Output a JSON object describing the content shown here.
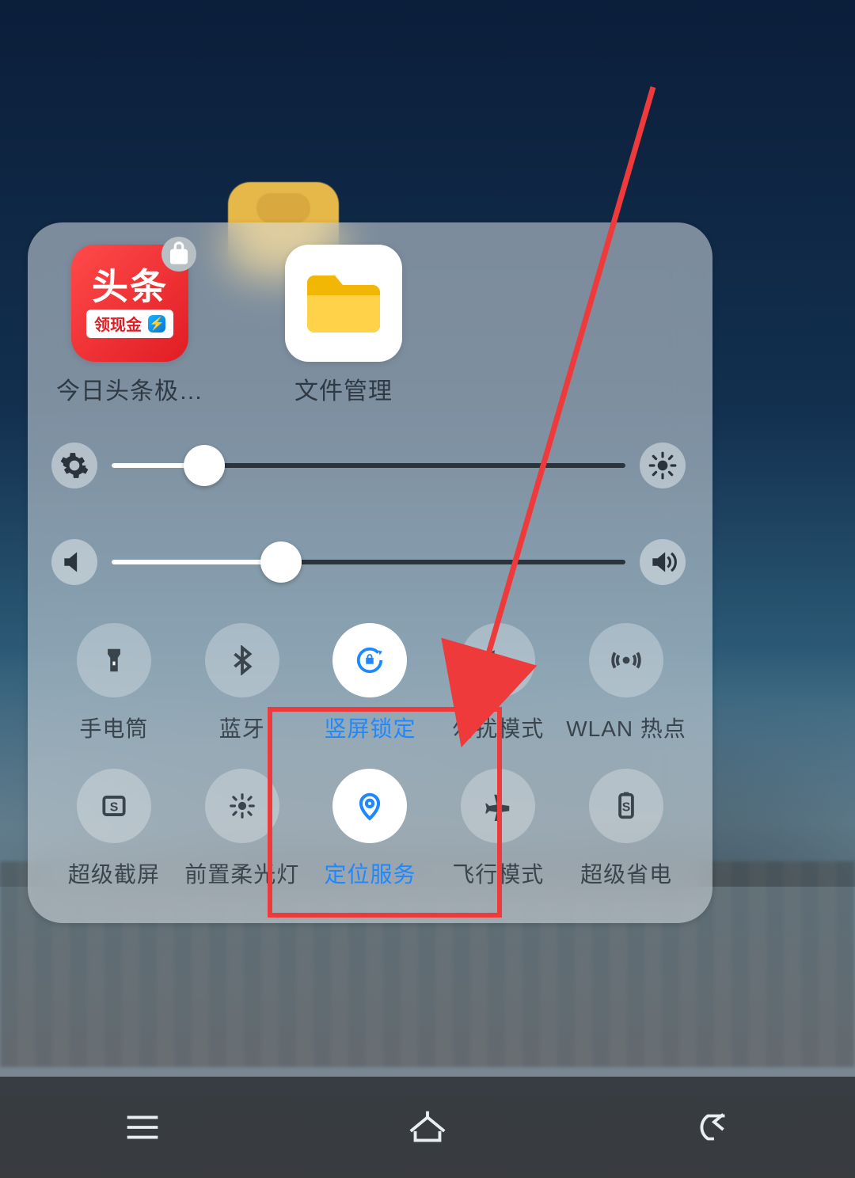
{
  "apps": [
    {
      "label": "今日头条极…",
      "icon": "toutiao",
      "icon_text": "头条",
      "icon_badge": "领现金",
      "locked": true
    },
    {
      "label": "文件管理",
      "icon": "folder"
    }
  ],
  "sliders": {
    "brightness": {
      "percent": 18,
      "left_icon": "gear",
      "right_icon": "sun"
    },
    "volume": {
      "percent": 33,
      "left_icon": "speaker-mute",
      "right_icon": "speaker-loud"
    }
  },
  "toggles": [
    {
      "id": "flashlight",
      "label": "手电筒",
      "icon": "flashlight",
      "active": false
    },
    {
      "id": "bluetooth",
      "label": "蓝牙",
      "icon": "bluetooth",
      "active": false
    },
    {
      "id": "portrait-lock",
      "label": "竖屏锁定",
      "icon": "rotation-lock",
      "active": true
    },
    {
      "id": "dnd",
      "label": "勿扰模式",
      "icon": "moon",
      "active": false
    },
    {
      "id": "wlan-hotspot",
      "label": "WLAN 热点",
      "icon": "hotspot",
      "active": false
    },
    {
      "id": "super-screenshot",
      "label": "超级截屏",
      "icon": "screenshot",
      "active": false
    },
    {
      "id": "front-fill-light",
      "label": "前置柔光灯",
      "icon": "sun-small",
      "active": false
    },
    {
      "id": "location",
      "label": "定位服务",
      "icon": "location-pin",
      "active": true
    },
    {
      "id": "airplane",
      "label": "飞行模式",
      "icon": "airplane",
      "active": false
    },
    {
      "id": "super-battery",
      "label": "超级省电",
      "icon": "battery-saver",
      "active": false
    }
  ],
  "annotation": {
    "highlight_toggle": "location",
    "arrow_target": "dnd",
    "color": "#ef3a3c"
  },
  "nav": [
    {
      "id": "recent",
      "icon": "menu"
    },
    {
      "id": "home",
      "icon": "home"
    },
    {
      "id": "back",
      "icon": "back"
    }
  ]
}
